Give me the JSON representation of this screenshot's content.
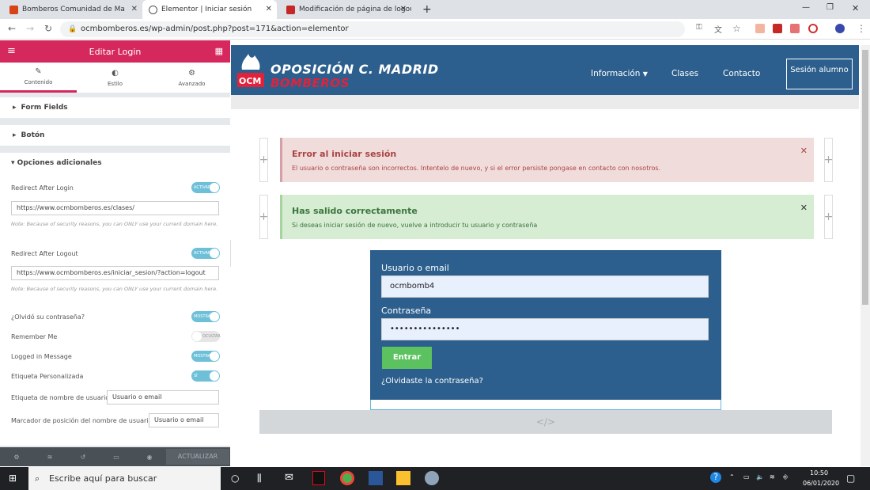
{
  "browser": {
    "tabs": [
      {
        "label": "Bomberos Comunidad de Ma"
      },
      {
        "label": "Elementor | Iniciar sesión"
      },
      {
        "label": "Modificación de página de logou"
      }
    ],
    "url": "ocmbomberos.es/wp-admin/post.php?post=171&action=elementor"
  },
  "panel": {
    "title": "Editar Login",
    "tabs": [
      {
        "label": "Contenido"
      },
      {
        "label": "Estilo"
      },
      {
        "label": "Avanzado"
      }
    ],
    "sections": [
      {
        "label": "Form Fields"
      },
      {
        "label": "Botón"
      },
      {
        "label": "Opciones adicionales"
      }
    ],
    "redirect_login_label": "Redirect After Login",
    "redirect_login_value": "https://www.ocmbomberos.es/clases/",
    "note": "Note: Because of security reasons, you can ONLY use your current domain here.",
    "redirect_logout_label": "Redirect After Logout",
    "redirect_logout_value": "https://www.ocmbomberos.es/iniciar_sesion/?action=logout",
    "forgot_label": "¿Olvidó su contraseña?",
    "remember_label": "Remember Me",
    "logged_label": "Logged in Message",
    "custom_label": "Etiqueta Personalizada",
    "username_label_label": "Etiqueta de nombre de usuario",
    "username_label_value": "Usuario o email",
    "username_placeholder_label": "Marcador de posición del nombre de usuario",
    "username_placeholder_value": "Usuario o email",
    "toggle_active": "ACTIVAR",
    "toggle_show": "MOSTRAR",
    "toggle_hide": "OCULTAR",
    "toggle_yes": "SÍ",
    "update": "ACTUALIZAR"
  },
  "site": {
    "logo_line1": "OPOSICIÓN C. MADRID",
    "logo_line2": "BOMBEROS",
    "logo_mark": "OCM",
    "nav": [
      {
        "label": "Información"
      },
      {
        "label": "Clases"
      },
      {
        "label": "Contacto"
      }
    ],
    "login_btn": "Sesión alumno",
    "error_title": "Error al iniciar sesión",
    "error_msg": "El usuario o contraseña son incorrectos. Intentelo de nuevo, y si el error persiste pongase en contacto con nosotros.",
    "ok_title": "Has salido correctamente",
    "ok_msg": "Si deseas iniciar sesión de nuevo, vuelve a introducir tu usuario y contraseña",
    "user_label": "Usuario o email",
    "user_value": "ocmbomb4",
    "pass_label": "Contraseña",
    "pass_value": "•••••••••••••••",
    "submit": "Entrar",
    "forgot": "¿Olvidaste la contraseña?",
    "code_icon": "</>"
  },
  "taskbar": {
    "search": "Escribe aquí para buscar",
    "time": "10:50",
    "date": "06/01/2020"
  }
}
